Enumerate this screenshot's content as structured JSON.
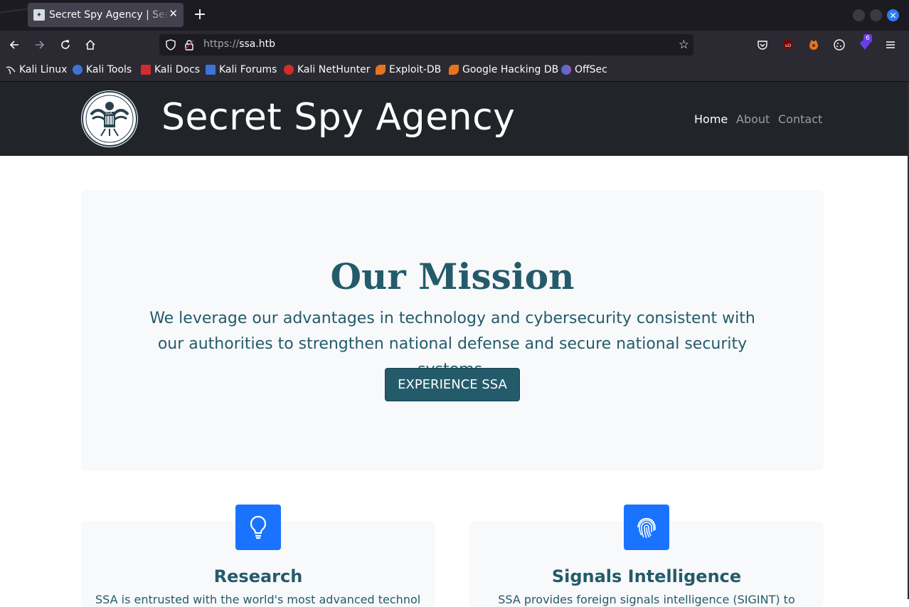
{
  "browser": {
    "tab_title": "Secret Spy Agency | Secret",
    "url_protocol": "https://",
    "url_host": "ssa.htb",
    "extension_badge": "6",
    "bookmarks": [
      "Kali Linux",
      "Kali Tools",
      "Kali Docs",
      "Kali Forums",
      "Kali NetHunter",
      "Exploit-DB",
      "Google Hacking DB",
      "OffSec"
    ]
  },
  "site": {
    "logo_text": "SSA",
    "title": "Secret Spy Agency",
    "nav": [
      "Home",
      "About",
      "Contact"
    ]
  },
  "hero": {
    "title": "Our Mission",
    "text": "We leverage our advantages in technology and cybersecurity consistent with our authorities to strengthen national defense and secure national security systems.",
    "button": "EXPERIENCE SSA"
  },
  "cards": [
    {
      "title": "Research",
      "text": "SSA is entrusted with the world's most advanced technology",
      "icon": "lightbulb-icon"
    },
    {
      "title": "Signals Intelligence",
      "text": "SSA provides foreign signals intelligence (SIGINT) to",
      "icon": "fingerprint-icon"
    }
  ],
  "colors": {
    "accent": "#245b6b",
    "icon_bg": "#1a73fe",
    "header_bg": "#212529",
    "hero_bg": "#f8f9fa"
  }
}
